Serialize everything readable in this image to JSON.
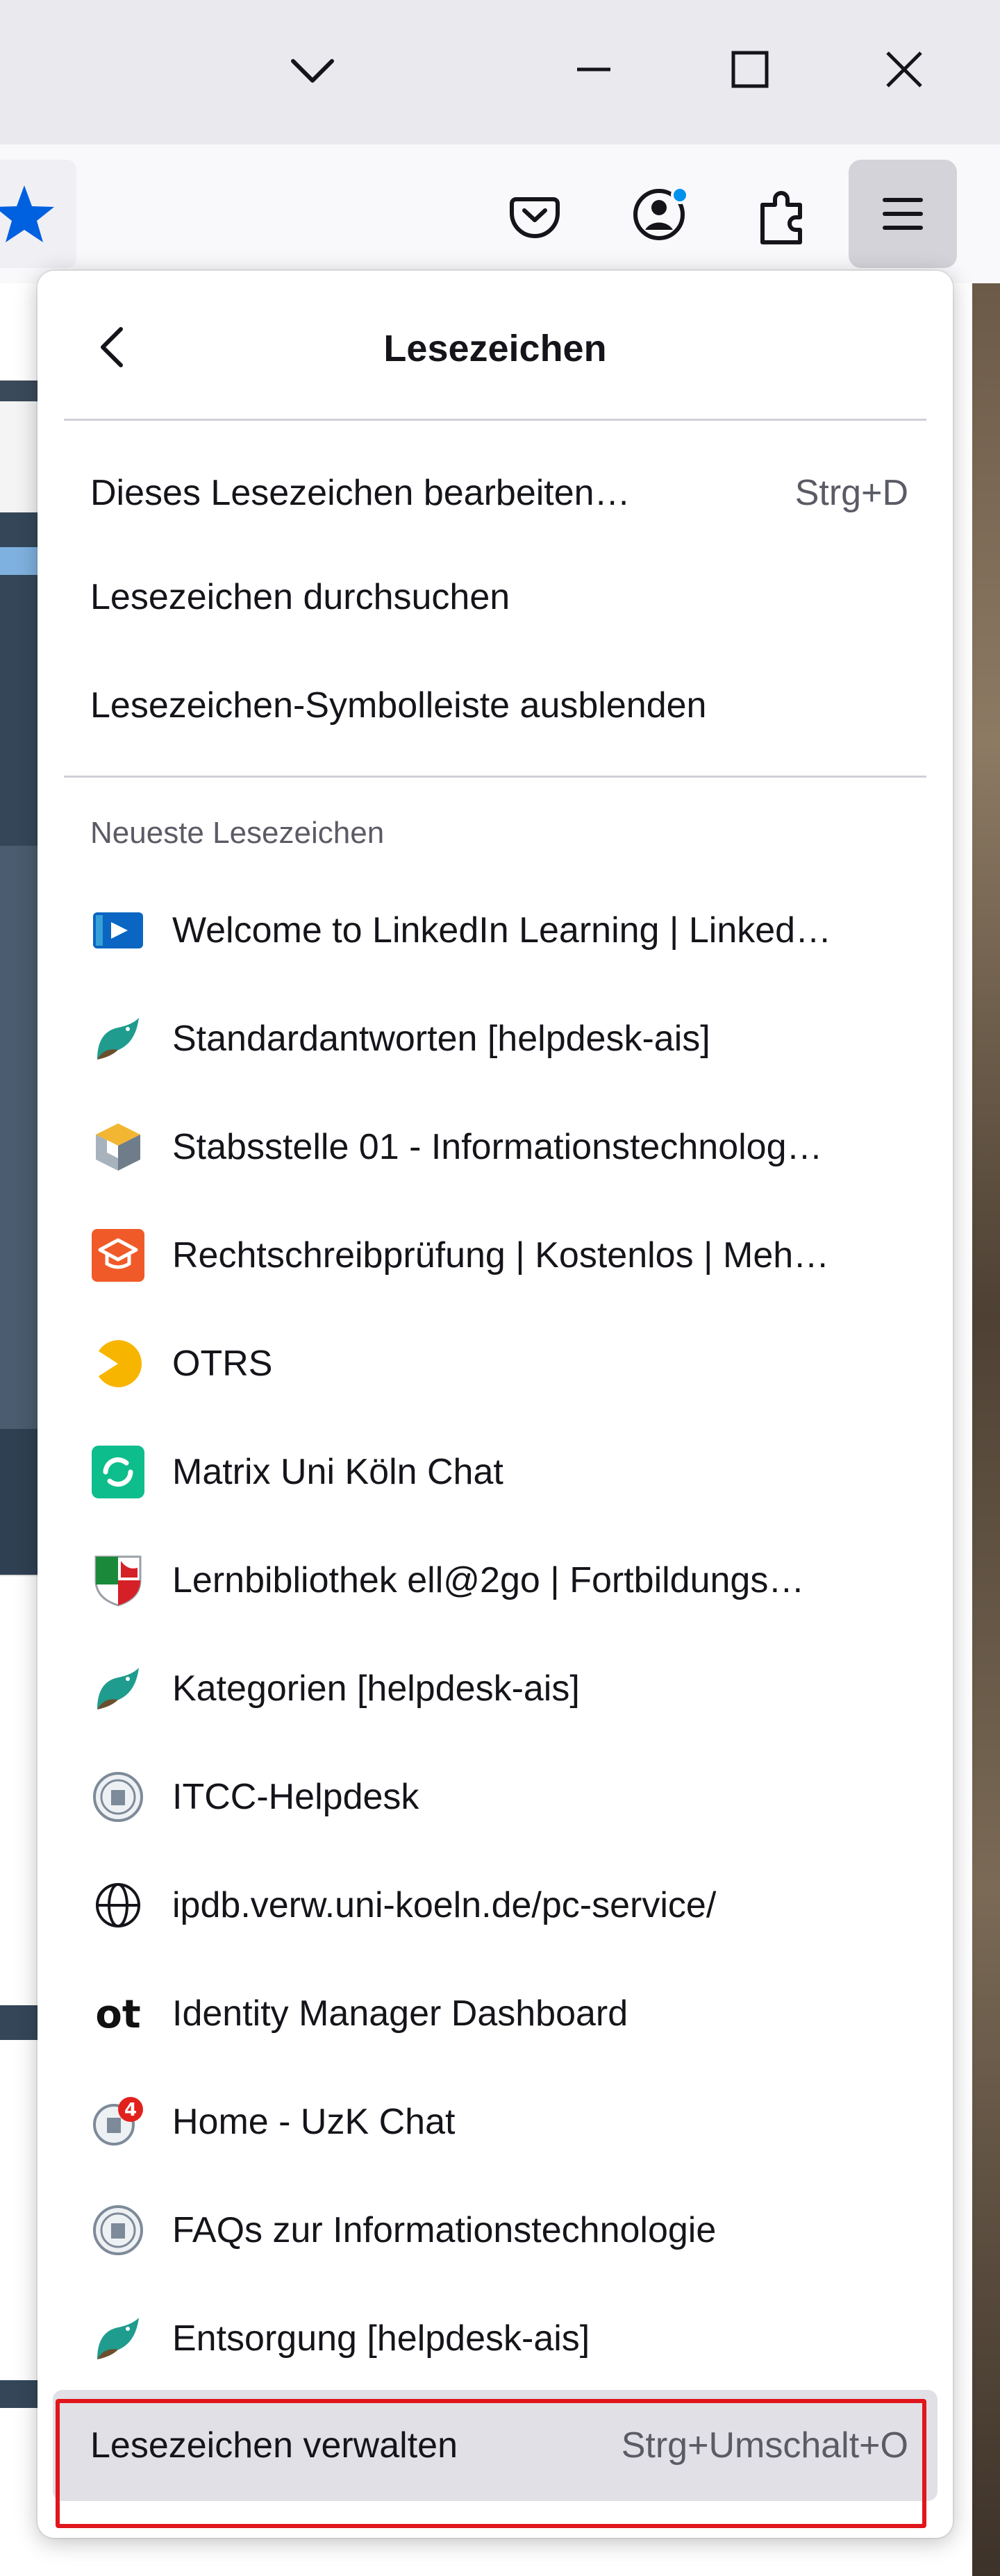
{
  "toolbar": {
    "buttons": [
      "star-icon",
      "pocket-icon",
      "account-icon",
      "extensions-icon",
      "menu-icon"
    ]
  },
  "panel": {
    "title": "Lesezeichen",
    "actions": [
      {
        "label": "Dieses Lesezeichen bearbeiten…",
        "shortcut": "Strg+D"
      },
      {
        "label": "Lesezeichen durchsuchen",
        "shortcut": ""
      },
      {
        "label": "Lesezeichen-Symbolleiste ausblenden",
        "shortcut": ""
      }
    ],
    "recent_heading": "Neueste Lesezeichen",
    "recent": [
      {
        "label": "Welcome to LinkedIn Learning | Linked…",
        "icon": "linkedin-learning-icon"
      },
      {
        "label": "Standardantworten [helpdesk-ais]",
        "icon": "helpdesk-bird-icon"
      },
      {
        "label": "Stabsstelle 01 - Informationstechnolog…",
        "icon": "cube-icon"
      },
      {
        "label": "Rechtschreibprüfung | Kostenlos | Meh…",
        "icon": "graduation-cap-icon"
      },
      {
        "label": "OTRS",
        "icon": "otrs-icon"
      },
      {
        "label": "Matrix Uni Köln Chat",
        "icon": "matrix-chat-icon"
      },
      {
        "label": "Lernbibliothek ell@2go | Fortbildungs…",
        "icon": "nrw-crest-icon"
      },
      {
        "label": "Kategorien [helpdesk-ais]",
        "icon": "helpdesk-bird-icon"
      },
      {
        "label": "ITCC-Helpdesk",
        "icon": "university-seal-icon"
      },
      {
        "label": "ipdb.verw.uni-koeln.de/pc-service/",
        "icon": "globe-icon"
      },
      {
        "label": "Identity Manager Dashboard",
        "icon": "ot-logo-icon"
      },
      {
        "label": "Home - UzK Chat",
        "icon": "uzk-chat-icon"
      },
      {
        "label": "FAQs zur Informationstechnologie",
        "icon": "university-seal-icon"
      },
      {
        "label": "Entsorgung [helpdesk-ais]",
        "icon": "helpdesk-bird-icon"
      }
    ],
    "manage": {
      "label": "Lesezeichen verwalten",
      "shortcut": "Strg+Umschalt+O"
    },
    "badges": {
      "uzk_chat_count": "4"
    },
    "ot_logo_text": "ot"
  },
  "colors": {
    "accent_blue": "#0061e0",
    "highlight_red": "#e0161c",
    "pocket_red": "#ef4056",
    "badge_blue": "#0090ed"
  }
}
